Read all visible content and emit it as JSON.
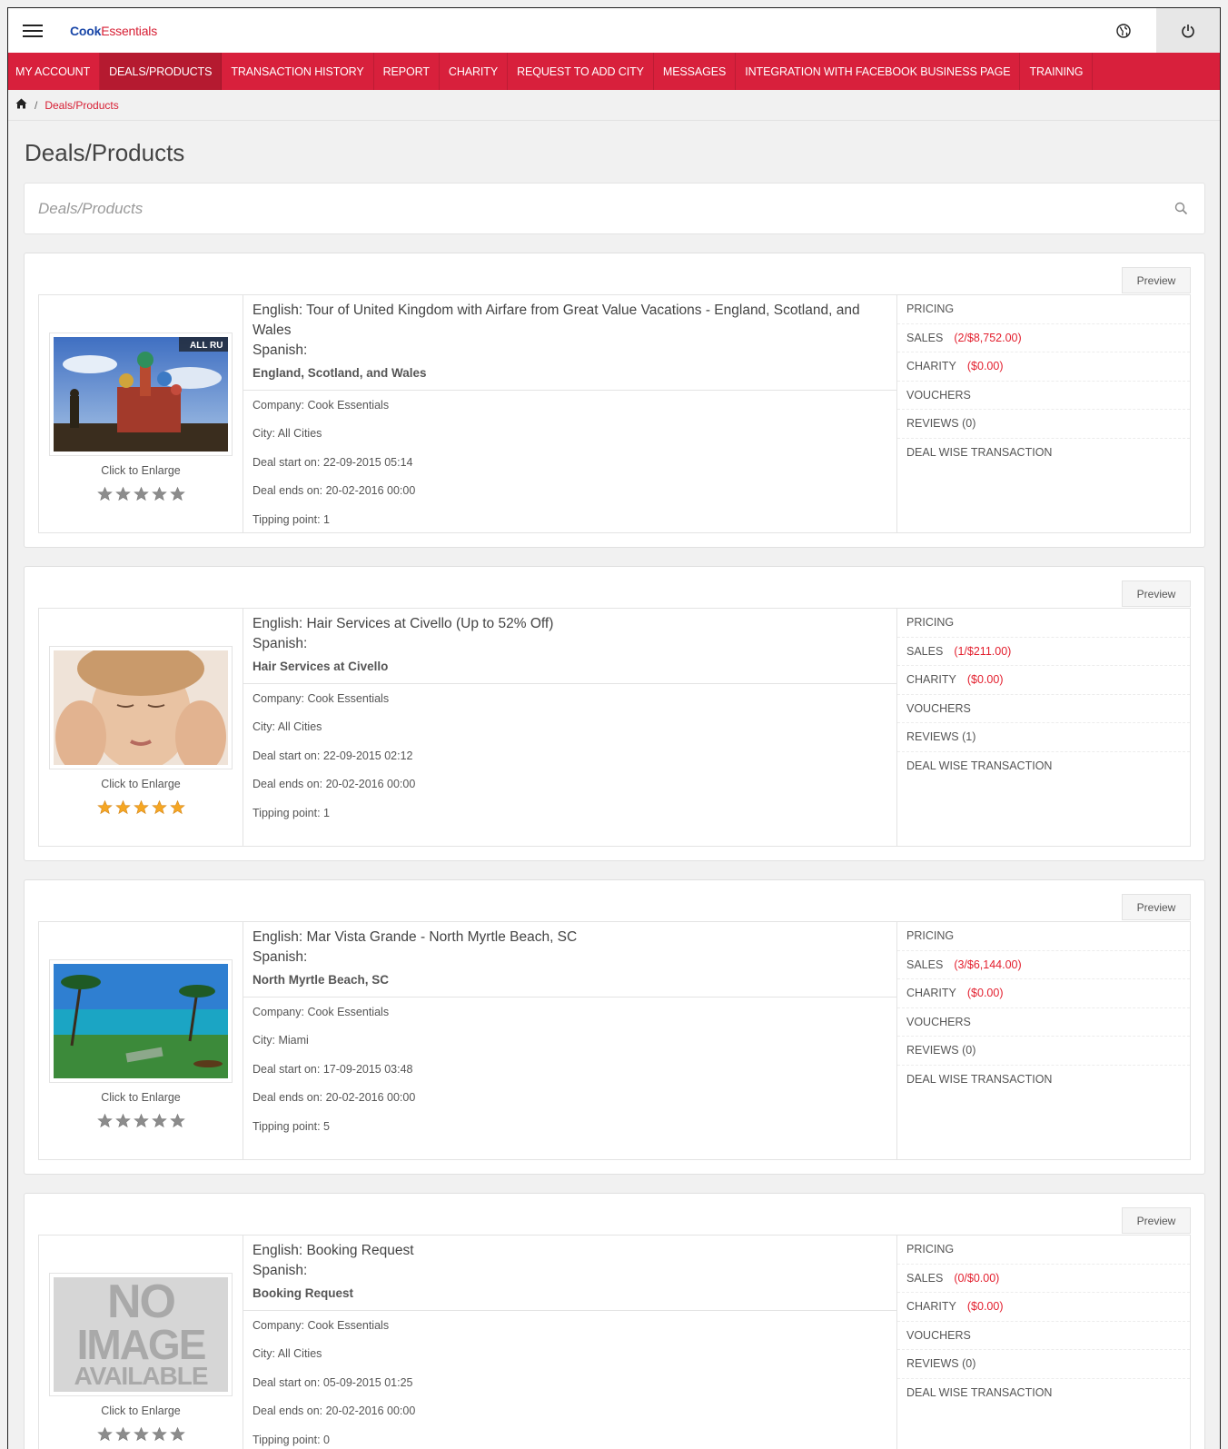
{
  "app": {
    "logo_part1": "Cook",
    "logo_part2": "Essentials"
  },
  "nav": {
    "items": [
      {
        "label": "MY ACCOUNT"
      },
      {
        "label": "DEALS/PRODUCTS"
      },
      {
        "label": "TRANSACTION HISTORY"
      },
      {
        "label": "REPORT"
      },
      {
        "label": "CHARITY"
      },
      {
        "label": "REQUEST TO ADD CITY"
      },
      {
        "label": "MESSAGES"
      },
      {
        "label": "INTEGRATION WITH FACEBOOK BUSINESS PAGE"
      },
      {
        "label": "TRAINING"
      }
    ],
    "active_index": 1
  },
  "breadcrumb": {
    "separator": "/",
    "current": "Deals/Products"
  },
  "page": {
    "title": "Deals/Products"
  },
  "search": {
    "placeholder": "Deals/Products"
  },
  "colors": {
    "brand_red": "#d8203c",
    "brand_blue": "#1a47a8",
    "accent_red_text": "#e31e2d",
    "star_gold": "#f5a623",
    "star_gray": "#8c8c8c"
  },
  "deals": [
    {
      "preview_label": "Preview",
      "title_en": "English: Tour of United Kingdom with Airfare from Great Value Vacations - England, Scotland, and Wales",
      "title_es": "Spanish:",
      "subtitle": "England, Scotland, and Wales",
      "company": "Company: Cook Essentials",
      "city": "City: All Cities",
      "start": "Deal start on: 22-09-2015 05:14",
      "ends": "Deal ends on: 20-02-2016 00:00",
      "tipping": "Tipping point: 1",
      "enlarge": "Click to Enlarge",
      "image_caption": "ALL RU",
      "stars_rating": 0,
      "links": {
        "pricing": "PRICING",
        "sales": "SALES",
        "sales_value": "(2/$8,752.00)",
        "charity": "CHARITY",
        "charity_value": "($0.00)",
        "vouchers": "VOUCHERS",
        "reviews": "REVIEWS (0)",
        "deal_wise": "DEAL WISE TRANSACTION"
      }
    },
    {
      "preview_label": "Preview",
      "title_en": "English: Hair Services at Civello (Up to 52% Off)",
      "title_es": "Spanish:",
      "subtitle": "Hair Services at Civello",
      "company": "Company: Cook Essentials",
      "city": "City: All Cities",
      "start": "Deal start on: 22-09-2015 02:12",
      "ends": "Deal ends on: 20-02-2016 00:00",
      "tipping": "Tipping point: 1",
      "enlarge": "Click to Enlarge",
      "stars_rating": 5,
      "links": {
        "pricing": "PRICING",
        "sales": "SALES",
        "sales_value": "(1/$211.00)",
        "charity": "CHARITY",
        "charity_value": "($0.00)",
        "vouchers": "VOUCHERS",
        "reviews": "REVIEWS (1)",
        "deal_wise": "DEAL WISE TRANSACTION"
      }
    },
    {
      "preview_label": "Preview",
      "title_en": "English: Mar Vista Grande - North Myrtle Beach, SC",
      "title_es": "Spanish:",
      "subtitle": "North Myrtle Beach, SC",
      "company": "Company: Cook Essentials",
      "city": "City: Miami",
      "start": "Deal start on: 17-09-2015 03:48",
      "ends": "Deal ends on: 20-02-2016 00:00",
      "tipping": "Tipping point: 5",
      "enlarge": "Click to Enlarge",
      "stars_rating": 0,
      "links": {
        "pricing": "PRICING",
        "sales": "SALES",
        "sales_value": "(3/$6,144.00)",
        "charity": "CHARITY",
        "charity_value": "($0.00)",
        "vouchers": "VOUCHERS",
        "reviews": "REVIEWS (0)",
        "deal_wise": "DEAL WISE TRANSACTION"
      }
    },
    {
      "preview_label": "Preview",
      "title_en": "English: Booking Request",
      "title_es": "Spanish:",
      "subtitle": "Booking Request",
      "company": "Company: Cook Essentials",
      "city": "City: All Cities",
      "start": "Deal start on: 05-09-2015 01:25",
      "ends": "Deal ends on: 20-02-2016 00:00",
      "tipping": "Tipping point: 0",
      "enlarge": "Click to Enlarge",
      "no_image_line1": "NO",
      "no_image_line2": "IMAGE",
      "no_image_line3": "AVAILABLE",
      "stars_rating": 0,
      "links": {
        "pricing": "PRICING",
        "sales": "SALES",
        "sales_value": "(0/$0.00)",
        "charity": "CHARITY",
        "charity_value": "($0.00)",
        "vouchers": "VOUCHERS",
        "reviews": "REVIEWS (0)",
        "deal_wise": "DEAL WISE TRANSACTION"
      }
    }
  ]
}
